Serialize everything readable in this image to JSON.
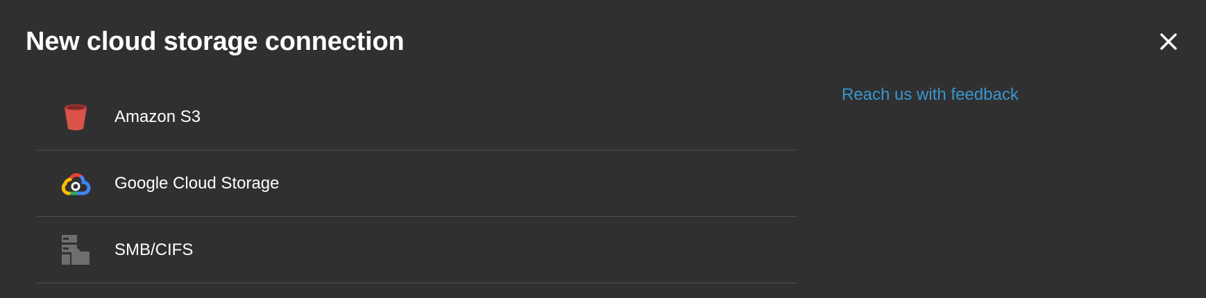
{
  "dialog": {
    "title": "New cloud storage connection",
    "close_icon": "close-icon"
  },
  "providers": [
    {
      "label": "Amazon S3",
      "icon": "amazon-s3-bucket-icon",
      "color": "#d9534a"
    },
    {
      "label": "Google Cloud Storage",
      "icon": "google-cloud-icon",
      "colors": [
        "#ea4335",
        "#4285f4",
        "#34a853",
        "#fbbc04"
      ]
    },
    {
      "label": "SMB/CIFS",
      "icon": "smb-server-folder-icon",
      "color": "#6e6e6e"
    }
  ],
  "sidebar": {
    "feedback_link": "Reach us with feedback",
    "link_color": "#3a96d0"
  },
  "colors": {
    "background": "#303030",
    "divider": "#4d4d4d"
  }
}
